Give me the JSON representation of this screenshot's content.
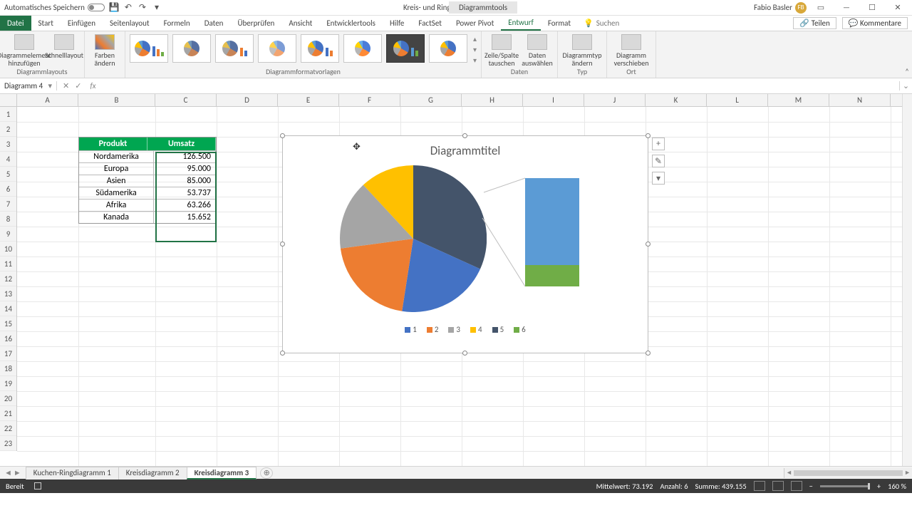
{
  "titlebar": {
    "autosave_label": "Automatisches Speichern",
    "doc_title": "Kreis- und Ringdiagramme  -  Excel",
    "tool_tab": "Diagrammtools",
    "user_name": "Fabio Basler",
    "user_initials": "FB"
  },
  "menu": {
    "file": "Datei",
    "tabs": [
      "Start",
      "Einfügen",
      "Seitenlayout",
      "Formeln",
      "Daten",
      "Überprüfen",
      "Ansicht",
      "Entwicklertools",
      "Hilfe",
      "FactSet",
      "Power Pivot",
      "Entwurf",
      "Format"
    ],
    "active_tab": "Entwurf",
    "search_placeholder": "Suchen",
    "share": "Teilen",
    "comments": "Kommentare"
  },
  "ribbon": {
    "group_layouts_label": "Diagrammlayouts",
    "add_element": "Diagrammelement hinzufügen",
    "quick_layout": "Schnelllayout",
    "change_colors": "Farben ändern",
    "group_styles_label": "Diagrammformatvorlagen",
    "group_data_label": "Daten",
    "switch_rowcol": "Zeile/Spalte tauschen",
    "select_data": "Daten auswählen",
    "group_type_label": "Typ",
    "change_type": "Diagrammtyp ändern",
    "group_location_label": "Ort",
    "move_chart": "Diagramm verschieben"
  },
  "fbar": {
    "name": "Diagramm 4",
    "formula": ""
  },
  "columns": [
    "A",
    "B",
    "C",
    "D",
    "E",
    "F",
    "G",
    "H",
    "I",
    "J",
    "K",
    "L",
    "M",
    "N"
  ],
  "rows": 23,
  "table": {
    "header_product": "Produkt",
    "header_value": "Umsatz",
    "rows": [
      {
        "p": "Nordamerika",
        "v": "126.500"
      },
      {
        "p": "Europa",
        "v": "95.000"
      },
      {
        "p": "Asien",
        "v": "85.000"
      },
      {
        "p": "Südamerika",
        "v": "53.737"
      },
      {
        "p": "Afrika",
        "v": "63.266"
      },
      {
        "p": "Kanada",
        "v": "15.652"
      }
    ]
  },
  "chart": {
    "title": "Diagrammtitel",
    "legend": [
      "1",
      "2",
      "3",
      "4",
      "5",
      "6"
    ],
    "legend_colors": [
      "#4472c4",
      "#ed7d31",
      "#a5a5a5",
      "#ffc000",
      "#44546a",
      "#70ad47"
    ]
  },
  "chart_data": {
    "type": "pie",
    "subtype": "bar-of-pie",
    "title": "Diagrammtitel",
    "categories": [
      "Nordamerika",
      "Europa",
      "Asien",
      "Südamerika",
      "Afrika",
      "Kanada"
    ],
    "values": [
      126500,
      95000,
      85000,
      53737,
      63266,
      15652
    ],
    "series_name": "Umsatz",
    "secondary_plot_categories": [
      "Afrika",
      "Kanada"
    ],
    "legend_labels": [
      "1",
      "2",
      "3",
      "4",
      "5",
      "6"
    ],
    "colors": [
      "#4472c4",
      "#ed7d31",
      "#a5a5a5",
      "#ffc000",
      "#44546a",
      "#70ad47"
    ]
  },
  "sheets": {
    "tabs": [
      "Kuchen-Ringdiagramm 1",
      "Kreisdiagramm 2",
      "Kreisdiagramm 3"
    ],
    "active": "Kreisdiagramm 3"
  },
  "status": {
    "ready": "Bereit",
    "mean_label": "Mittelwert:",
    "mean": "73.192",
    "count_label": "Anzahl:",
    "count": "6",
    "sum_label": "Summe:",
    "sum": "439.155",
    "zoom": "160 %"
  }
}
